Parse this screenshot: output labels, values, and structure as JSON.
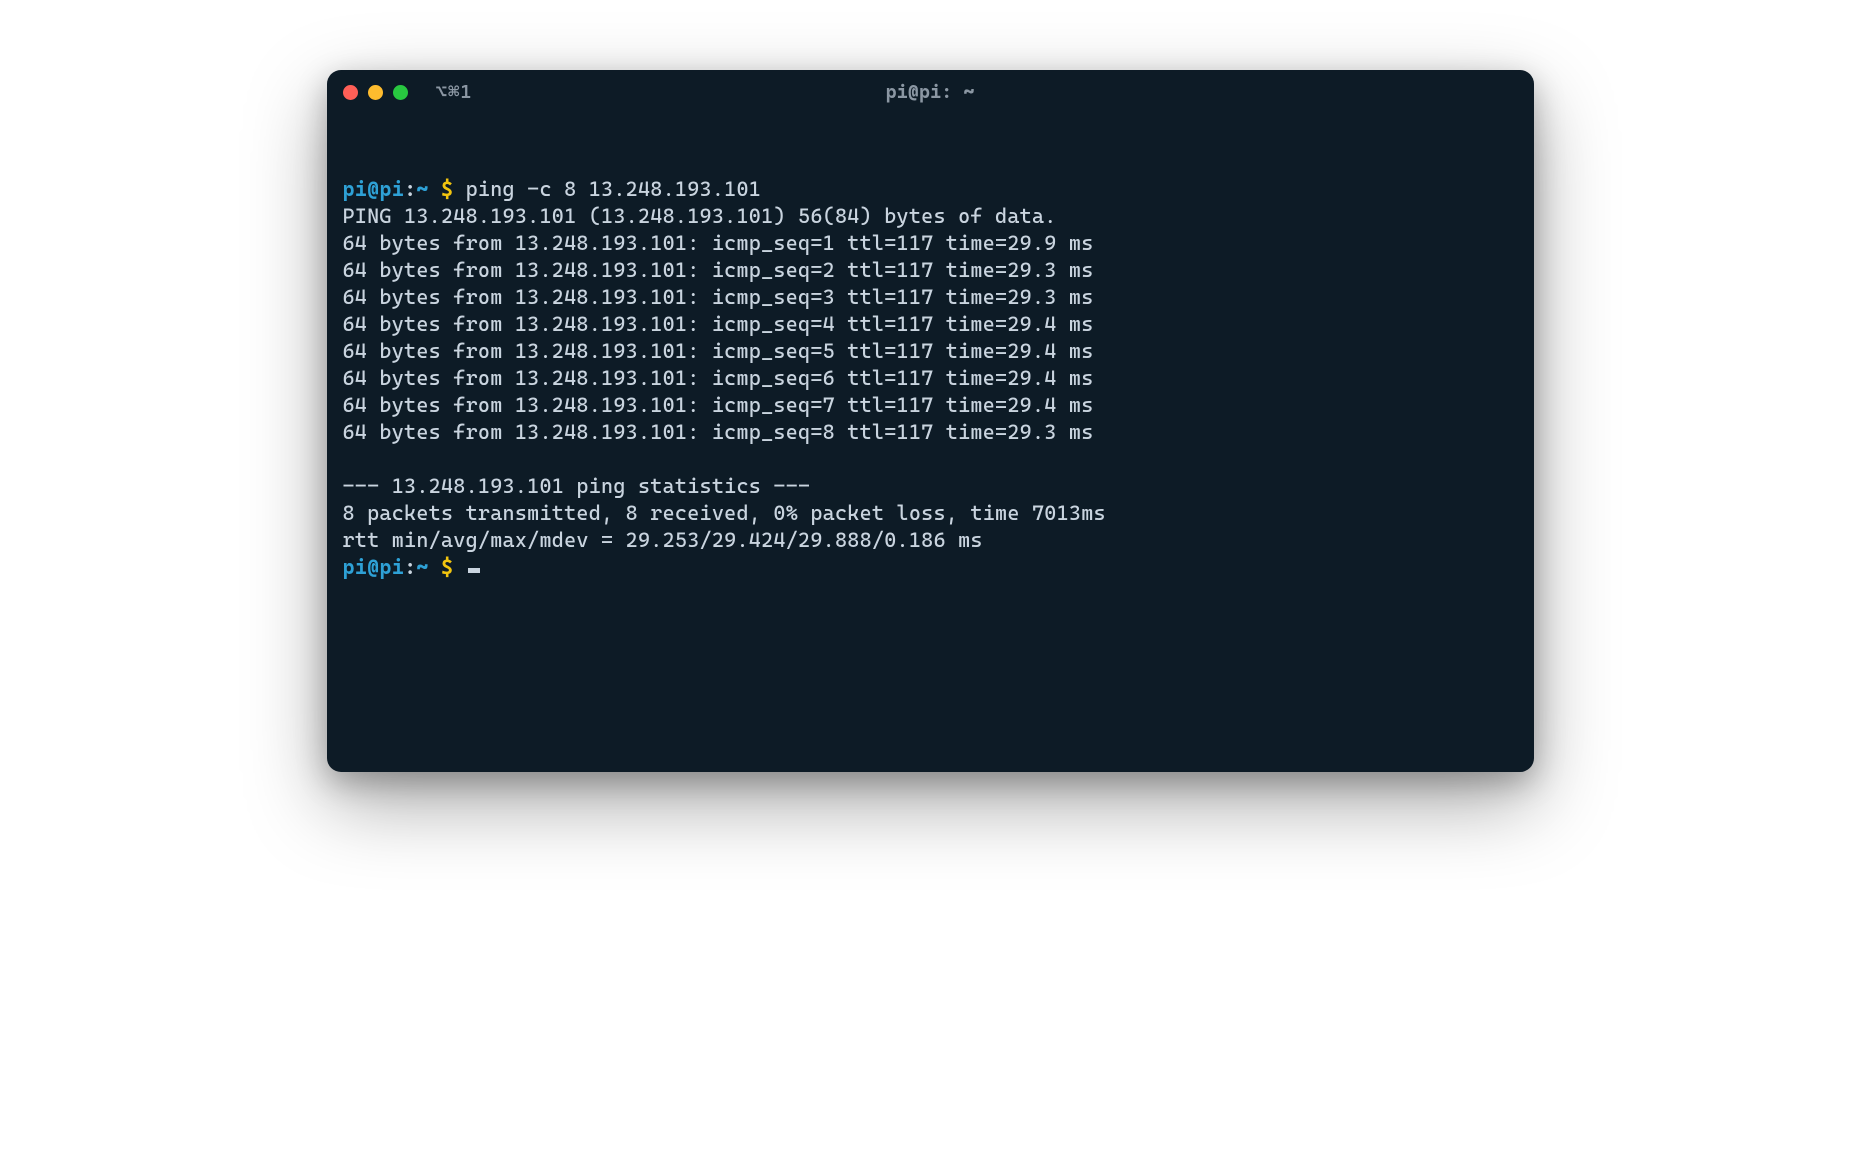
{
  "colors": {
    "background": "#0d1b26",
    "foreground": "#c9d4df",
    "prompt_user": "#2ea1d6",
    "prompt_symbol": "#f1c40f",
    "tl_close": "#ff5f57",
    "tl_min": "#febc2e",
    "tl_max": "#28c840"
  },
  "titlebar": {
    "tab_indicator": "⌥⌘1",
    "title": "pi@pi: ~"
  },
  "session": {
    "prompt": {
      "user_host": "pi@pi",
      "separator": ":",
      "path": "~",
      "symbol": "$"
    },
    "command": "ping -c 8 13.248.193.101",
    "output_lines": [
      "PING 13.248.193.101 (13.248.193.101) 56(84) bytes of data.",
      "64 bytes from 13.248.193.101: icmp_seq=1 ttl=117 time=29.9 ms",
      "64 bytes from 13.248.193.101: icmp_seq=2 ttl=117 time=29.3 ms",
      "64 bytes from 13.248.193.101: icmp_seq=3 ttl=117 time=29.3 ms",
      "64 bytes from 13.248.193.101: icmp_seq=4 ttl=117 time=29.4 ms",
      "64 bytes from 13.248.193.101: icmp_seq=5 ttl=117 time=29.4 ms",
      "64 bytes from 13.248.193.101: icmp_seq=6 ttl=117 time=29.4 ms",
      "64 bytes from 13.248.193.101: icmp_seq=7 ttl=117 time=29.4 ms",
      "64 bytes from 13.248.193.101: icmp_seq=8 ttl=117 time=29.3 ms",
      "",
      "--- 13.248.193.101 ping statistics ---",
      "8 packets transmitted, 8 received, 0% packet loss, time 7013ms",
      "rtt min/avg/max/mdev = 29.253/29.424/29.888/0.186 ms"
    ]
  }
}
